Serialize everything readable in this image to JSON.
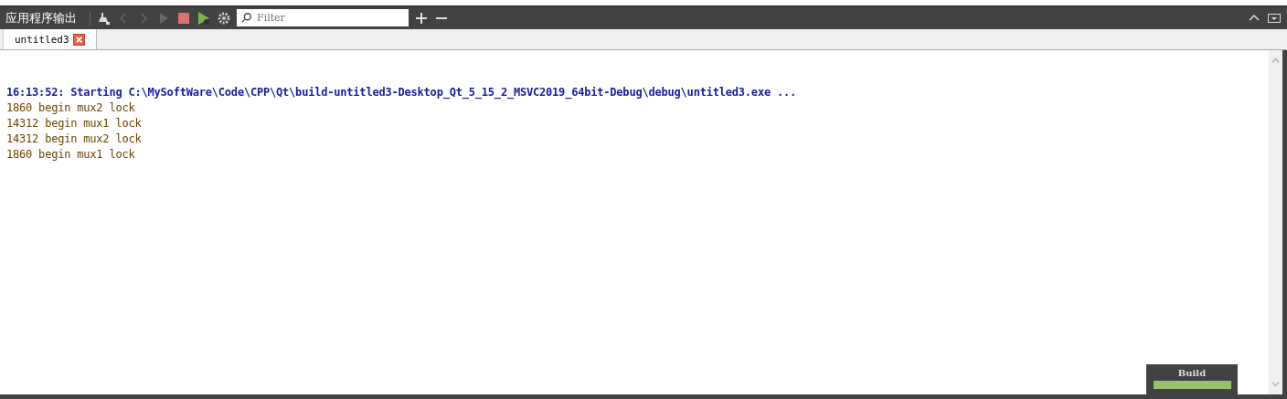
{
  "pane": {
    "title": "应用程序输出",
    "filter": {
      "placeholder": "Filter"
    }
  },
  "tabs": [
    {
      "label": "untitled3",
      "selected": true
    }
  ],
  "output": [
    {
      "kind": "start",
      "text": "16:13:52: Starting C:\\MySoftWare\\Code\\CPP\\Qt\\build-untitled3-Desktop_Qt_5_15_2_MSVC2019_64bit-Debug\\debug\\untitled3.exe ..."
    },
    {
      "kind": "stdout",
      "text": "1860 begin mux2 lock"
    },
    {
      "kind": "stdout",
      "text": "14312 begin mux1 lock"
    },
    {
      "kind": "stdout",
      "text": "14312 begin mux2 lock"
    },
    {
      "kind": "stdout",
      "text": "1860 begin mux1 lock"
    }
  ],
  "progress": {
    "label": "Build",
    "level": 1
  }
}
